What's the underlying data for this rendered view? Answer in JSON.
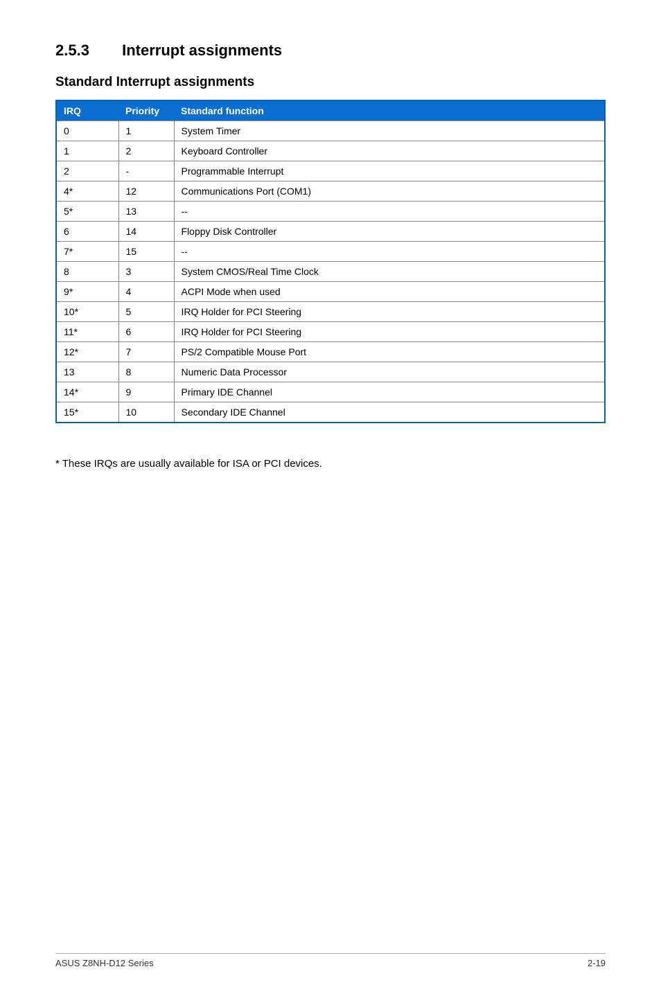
{
  "heading": {
    "number": "2.5.3",
    "title": "Interrupt assignments"
  },
  "sub_heading": "Standard Interrupt assignments",
  "table": {
    "headers": {
      "irq": "IRQ",
      "priority": "Priority",
      "func": "Standard function"
    },
    "rows": [
      {
        "irq": "0",
        "priority": "1",
        "func": "System Timer"
      },
      {
        "irq": "1",
        "priority": "2",
        "func": "Keyboard Controller"
      },
      {
        "irq": "2",
        "priority": "-",
        "func": "Programmable Interrupt"
      },
      {
        "irq": "4*",
        "priority": "12",
        "func": "Communications Port (COM1)"
      },
      {
        "irq": "5*",
        "priority": "13",
        "func": "--"
      },
      {
        "irq": "6",
        "priority": "14",
        "func": "Floppy Disk Controller"
      },
      {
        "irq": "7*",
        "priority": "15",
        "func": "--"
      },
      {
        "irq": "8",
        "priority": "3",
        "func": "System CMOS/Real Time Clock"
      },
      {
        "irq": "9*",
        "priority": "4",
        "func": "ACPI Mode when used"
      },
      {
        "irq": "10*",
        "priority": "5",
        "func": "IRQ Holder for PCI Steering"
      },
      {
        "irq": "11*",
        "priority": "6",
        "func": "IRQ Holder for PCI Steering"
      },
      {
        "irq": "12*",
        "priority": "7",
        "func": "PS/2 Compatible Mouse Port"
      },
      {
        "irq": "13",
        "priority": "8",
        "func": "Numeric Data Processor"
      },
      {
        "irq": "14*",
        "priority": "9",
        "func": "Primary IDE Channel"
      },
      {
        "irq": "15*",
        "priority": "10",
        "func": "Secondary IDE Channel"
      }
    ]
  },
  "note": "* These IRQs are usually available for ISA or PCI devices.",
  "footer": {
    "left": "ASUS Z8NH-D12 Series",
    "right": "2-19"
  }
}
